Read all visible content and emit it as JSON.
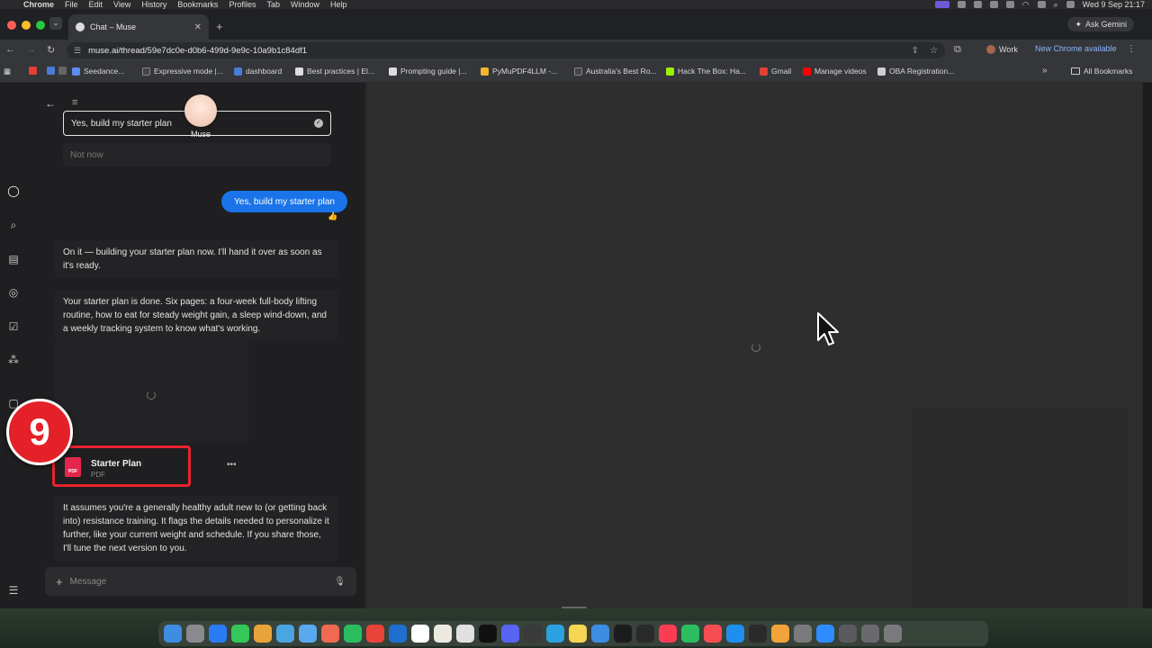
{
  "menubar": {
    "items": [
      "Chrome",
      "File",
      "Edit",
      "View",
      "History",
      "Bookmarks",
      "Profiles",
      "Tab",
      "Window",
      "Help"
    ],
    "clock": "Wed 9 Sep  21:17"
  },
  "browser": {
    "tab_title": "Chat – Muse",
    "url": "muse.ai/thread/59e7dc0e-d0b6-499d-9e9c-10a9b1c84df1",
    "ask_gemini": "Ask Gemini",
    "profile": "Work",
    "update_notice": "New Chrome available",
    "bookmarks": [
      {
        "label": "Seedance...",
        "color": "#5b8def"
      },
      {
        "label": "Expressive mode |...",
        "color": "#444"
      },
      {
        "label": "dashboard",
        "color": "#4a7bd8"
      },
      {
        "label": "Best practices | El...",
        "color": "#ddd"
      },
      {
        "label": "Prompting guide |...",
        "color": "#ddd"
      },
      {
        "label": "PyMuPDF4LLM -...",
        "color": "#f2b632"
      },
      {
        "label": "Australia's Best Ro...",
        "color": "#444"
      },
      {
        "label": "Hack The Box: Ha...",
        "color": "#9fef00"
      },
      {
        "label": "Gmail",
        "color": "#e34133"
      },
      {
        "label": "Manage videos",
        "color": "#ff0000"
      },
      {
        "label": "OBA Registration...",
        "color": "#cfcfcf"
      }
    ],
    "all_bookmarks": "All Bookmarks"
  },
  "chat": {
    "selected_option": "Yes, build my starter plan",
    "other_option": "Not now",
    "agent_name": "Muse",
    "user_message": "Yes, build my starter plan",
    "reaction": "👍",
    "assistant_1": "On it — building your starter plan now. I'll hand it over as soon as it's ready.",
    "assistant_2": "Your starter plan is done. Six pages: a four-week full-body lifting routine, how to eat for steady weight gain, a sleep wind-down, and a weekly tracking system to know what's working.",
    "file": {
      "name": "Starter Plan",
      "type": "PDF",
      "icon_label": "PDF"
    },
    "assistant_3": "It assumes you're a generally healthy adult new to (or getting back into) resistance training. It flags the details needed to personalize it further, like your current weight and schedule. If you share those, I'll tune the next version to you.",
    "composer_placeholder": "Message"
  },
  "overlay": {
    "step_number": "9",
    "accent": "#e42129"
  },
  "colors": {
    "user_bubble": "#1a73e8",
    "pdf_icon": "#e3264c",
    "highlight": "#e8232f"
  }
}
